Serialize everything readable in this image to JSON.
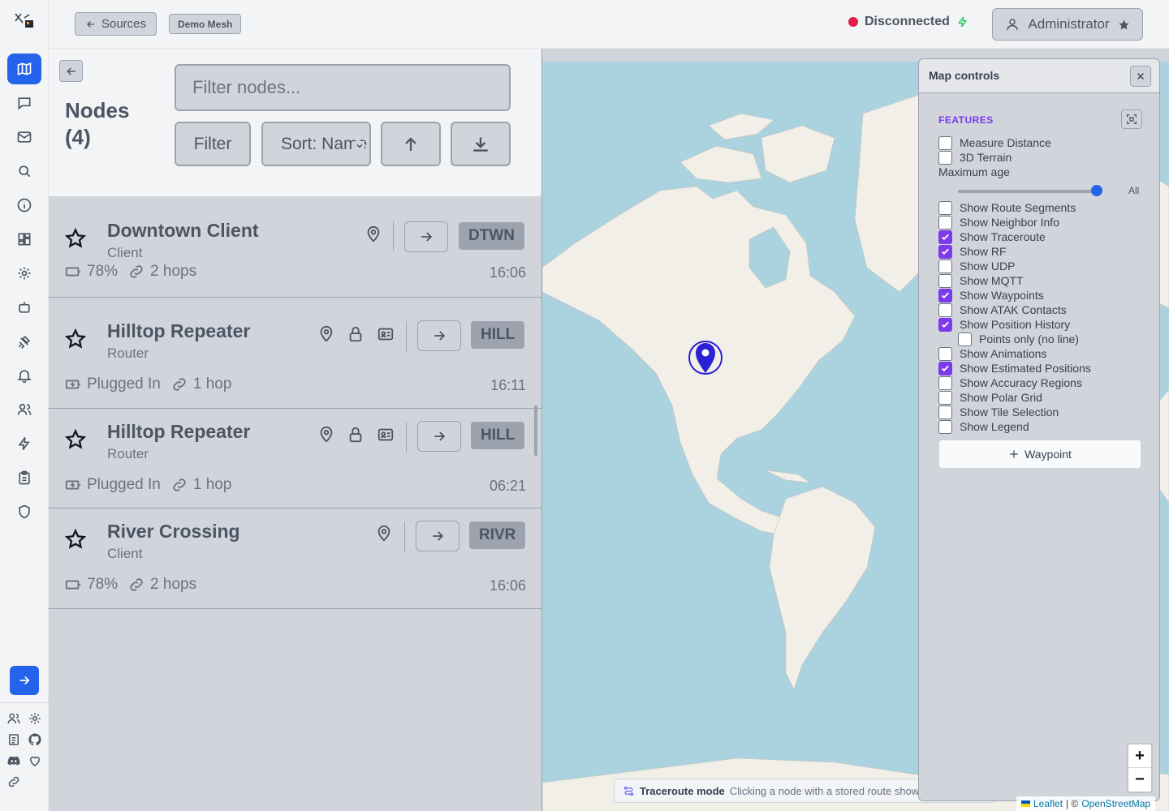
{
  "topbar": {
    "sources_label": "Sources",
    "mesh_name": "Demo Mesh",
    "connection_status": "Disconnected",
    "user_label": "Administrator"
  },
  "nodes_panel": {
    "title": "Nodes",
    "count": "(4)",
    "filter_placeholder": "Filter nodes...",
    "filter_label": "Filter",
    "sort_label": "Sort: Name",
    "nodes": [
      {
        "name": "Downtown Client",
        "role": "Client",
        "short": "DTWN",
        "power": "78%",
        "hops": "2 hops",
        "time": "16:06"
      },
      {
        "name": "Hilltop Repeater",
        "role": "Router",
        "short": "HILL",
        "power": "Plugged In",
        "hops": "1 hop",
        "time": "16:11"
      },
      {
        "name": "Hilltop Repeater",
        "role": "Router",
        "short": "HILL",
        "power": "Plugged In",
        "hops": "1 hop",
        "time": "06:21"
      },
      {
        "name": "River Crossing",
        "role": "Client",
        "short": "RIVR",
        "power": "78%",
        "hops": "2 hops",
        "time": "16:06"
      }
    ]
  },
  "map_controls": {
    "title": "Map controls",
    "features_label": "FEATURES",
    "max_age_label": "Maximum age",
    "max_age_value": "All",
    "options": [
      {
        "label": "Measure Distance",
        "checked": false
      },
      {
        "label": "3D Terrain",
        "checked": false
      },
      {
        "label": "Show Route Segments",
        "checked": false
      },
      {
        "label": "Show Neighbor Info",
        "checked": false
      },
      {
        "label": "Show Traceroute",
        "checked": true
      },
      {
        "label": "Show RF",
        "checked": true
      },
      {
        "label": "Show UDP",
        "checked": false
      },
      {
        "label": "Show MQTT",
        "checked": false
      },
      {
        "label": "Show Waypoints",
        "checked": true
      },
      {
        "label": "Show ATAK Contacts",
        "checked": false
      },
      {
        "label": "Show Position History",
        "checked": true
      },
      {
        "label": "Points only (no line)",
        "checked": false
      },
      {
        "label": "Show Animations",
        "checked": false
      },
      {
        "label": "Show Estimated Positions",
        "checked": true
      },
      {
        "label": "Show Accuracy Regions",
        "checked": false
      },
      {
        "label": "Show Polar Grid",
        "checked": false
      },
      {
        "label": "Show Tile Selection",
        "checked": false
      },
      {
        "label": "Show Legend",
        "checked": false
      }
    ],
    "waypoint_label": "Waypoint"
  },
  "map": {
    "traceroute_title": "Traceroute mode",
    "traceroute_text": "Clicking a node with a stored route shows",
    "zoom_in": "+",
    "zoom_out": "−",
    "attribution_leaflet": "Leaflet",
    "attribution_sep": "| ©",
    "attribution_osm": "OpenStreetMap"
  },
  "colors": {
    "accent": "#2563eb",
    "checkbox_checked": "#7c3aed",
    "status_disconnected": "#e11d48",
    "ocean": "#aad3df",
    "land": "#f2efe9"
  }
}
